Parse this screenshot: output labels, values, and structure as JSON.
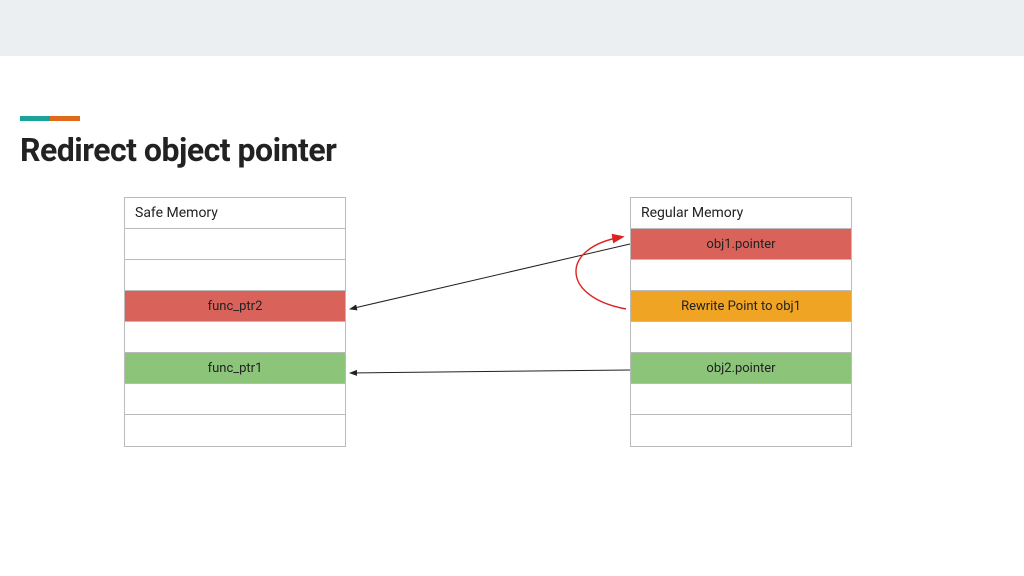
{
  "header": {
    "title": "Redirect object pointer"
  },
  "colors": {
    "accent_left": "#1aa39a",
    "accent_right": "#e06a1a",
    "red": "#d9635a",
    "green": "#8cc47a",
    "orange": "#f0a424"
  },
  "safe_memory": {
    "label": "Safe Memory",
    "rows": [
      {
        "text": "",
        "color": "none"
      },
      {
        "text": "",
        "color": "none"
      },
      {
        "text": "func_ptr2",
        "color": "red"
      },
      {
        "text": "",
        "color": "none"
      },
      {
        "text": "func_ptr1",
        "color": "green"
      },
      {
        "text": "",
        "color": "none"
      },
      {
        "text": "",
        "color": "none"
      }
    ]
  },
  "regular_memory": {
    "label": "Regular Memory",
    "rows": [
      {
        "text": "obj1.pointer",
        "color": "red"
      },
      {
        "text": "",
        "color": "none"
      },
      {
        "text": "Rewrite Point to obj1",
        "color": "orange"
      },
      {
        "text": "",
        "color": "none"
      },
      {
        "text": "obj2.pointer",
        "color": "green"
      },
      {
        "text": "",
        "color": "none"
      },
      {
        "text": "",
        "color": "none"
      }
    ]
  },
  "arrows": [
    {
      "from": "regular.obj1.pointer",
      "to": "safe.func_ptr2",
      "color": "#222",
      "kind": "straight"
    },
    {
      "from": "regular.obj2.pointer",
      "to": "safe.func_ptr1",
      "color": "#222",
      "kind": "straight"
    },
    {
      "from": "regular.rewrite",
      "to": "regular.obj1.pointer",
      "color": "#d22",
      "kind": "curved"
    }
  ]
}
